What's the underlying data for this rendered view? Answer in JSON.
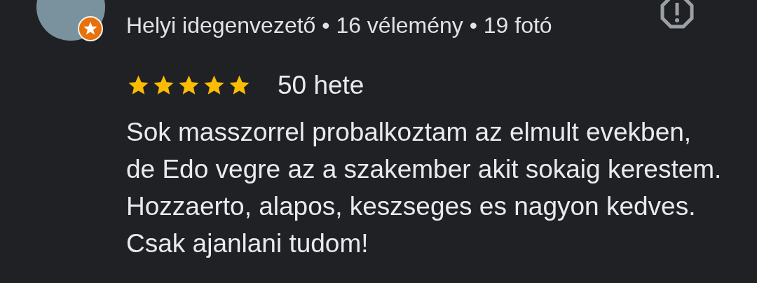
{
  "reviewer": {
    "subtitle": "Helyi idegenvezető • 16 vélemény • 19 fotó",
    "local_guide": true
  },
  "review": {
    "stars": 5,
    "time": "50 hete",
    "text": "Sok masszorrel probalkoztam az elmult evekben, de Edo vegre az a szakember akit sokaig kerestem. Hozzaerto, alapos, keszseges es nagyon kedves. Csak ajanlani tudom!"
  }
}
